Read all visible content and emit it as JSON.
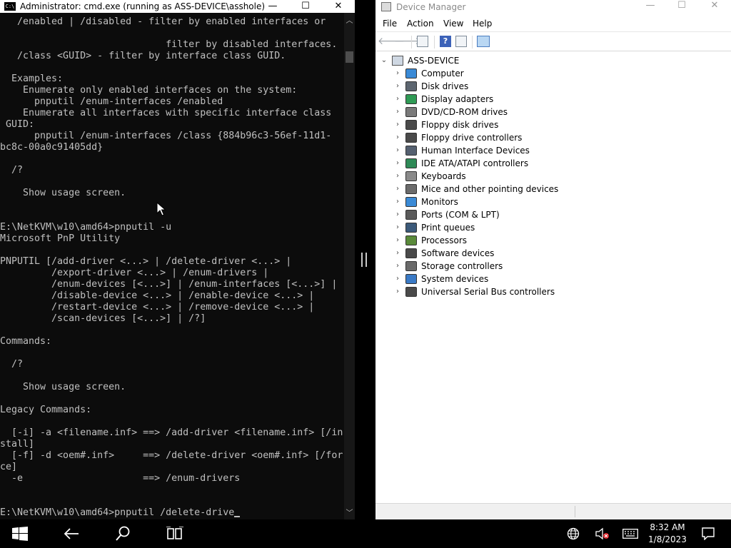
{
  "cmd": {
    "title": "Administrator: cmd.exe (running as ASS-DEVICE\\asshole)",
    "icon": "cmd-console-icon",
    "lines": [
      "   /enabled | /disabled - filter by enabled interfaces or",
      "",
      "                             filter by disabled interfaces.",
      "   /class <GUID> - filter by interface class GUID.",
      "",
      "  Examples:",
      "    Enumerate only enabled interfaces on the system:",
      "      pnputil /enum-interfaces /enabled",
      "    Enumerate all interfaces with specific interface class",
      " GUID:",
      "      pnputil /enum-interfaces /class {884b96c3-56ef-11d1-",
      "bc8c-00a0c91405dd}",
      "",
      "  /?",
      "",
      "    Show usage screen.",
      "",
      "",
      "E:\\NetKVM\\w10\\amd64>pnputil -u",
      "Microsoft PnP Utility",
      "",
      "PNPUTIL [/add-driver <...> | /delete-driver <...> |",
      "         /export-driver <...> | /enum-drivers |",
      "         /enum-devices [<...>] | /enum-interfaces [<...>] |",
      "         /disable-device <...> | /enable-device <...> |",
      "         /restart-device <...> | /remove-device <...> |",
      "         /scan-devices [<...>] | /?]",
      "",
      "Commands:",
      "",
      "  /?",
      "",
      "    Show usage screen.",
      "",
      "Legacy Commands:",
      "",
      "  [-i] -a <filename.inf> ==> /add-driver <filename.inf> [/in",
      "stall]",
      "  [-f] -d <oem#.inf>     ==> /delete-driver <oem#.inf> [/for",
      "ce]",
      "  -e                     ==> /enum-drivers",
      "",
      ""
    ],
    "prompt": "E:\\NetKVM\\w10\\amd64>pnputil /delete-drive"
  },
  "window_controls": {
    "minimize": "—",
    "maximize": "☐",
    "close": "✕"
  },
  "device_manager": {
    "title": "Device Manager",
    "menu": [
      "File",
      "Action",
      "View",
      "Help"
    ],
    "root": "ASS-DEVICE",
    "categories": [
      {
        "label": "Computer",
        "icon": "computer-icon",
        "color": "#3a8ad6"
      },
      {
        "label": "Disk drives",
        "icon": "disk-drive-icon",
        "color": "#5d6670"
      },
      {
        "label": "Display adapters",
        "icon": "display-adapter-icon",
        "color": "#2f9b55"
      },
      {
        "label": "DVD/CD-ROM drives",
        "icon": "dvd-drive-icon",
        "color": "#7a7a7a"
      },
      {
        "label": "Floppy disk drives",
        "icon": "floppy-disk-icon",
        "color": "#4a4a4a"
      },
      {
        "label": "Floppy drive controllers",
        "icon": "floppy-controller-icon",
        "color": "#4a4a4a"
      },
      {
        "label": "Human Interface Devices",
        "icon": "hid-icon",
        "color": "#556070"
      },
      {
        "label": "IDE ATA/ATAPI controllers",
        "icon": "ide-controller-icon",
        "color": "#2f8a57"
      },
      {
        "label": "Keyboards",
        "icon": "keyboard-icon",
        "color": "#8a8a8a"
      },
      {
        "label": "Mice and other pointing devices",
        "icon": "mouse-icon",
        "color": "#6b6b6b"
      },
      {
        "label": "Monitors",
        "icon": "monitor-icon",
        "color": "#3a8ad6"
      },
      {
        "label": "Ports (COM & LPT)",
        "icon": "port-icon",
        "color": "#5a5a5a"
      },
      {
        "label": "Print queues",
        "icon": "printer-icon",
        "color": "#3c5a7a"
      },
      {
        "label": "Processors",
        "icon": "processor-icon",
        "color": "#5a8a3a"
      },
      {
        "label": "Software devices",
        "icon": "software-device-icon",
        "color": "#4a4a4a"
      },
      {
        "label": "Storage controllers",
        "icon": "storage-controller-icon",
        "color": "#6a6a6a"
      },
      {
        "label": "System devices",
        "icon": "system-device-icon",
        "color": "#3a7ac6"
      },
      {
        "label": "Universal Serial Bus controllers",
        "icon": "usb-icon",
        "color": "#4a4a4a"
      }
    ]
  },
  "taskbar": {
    "time": "8:32 AM",
    "date": "1/8/2023"
  }
}
